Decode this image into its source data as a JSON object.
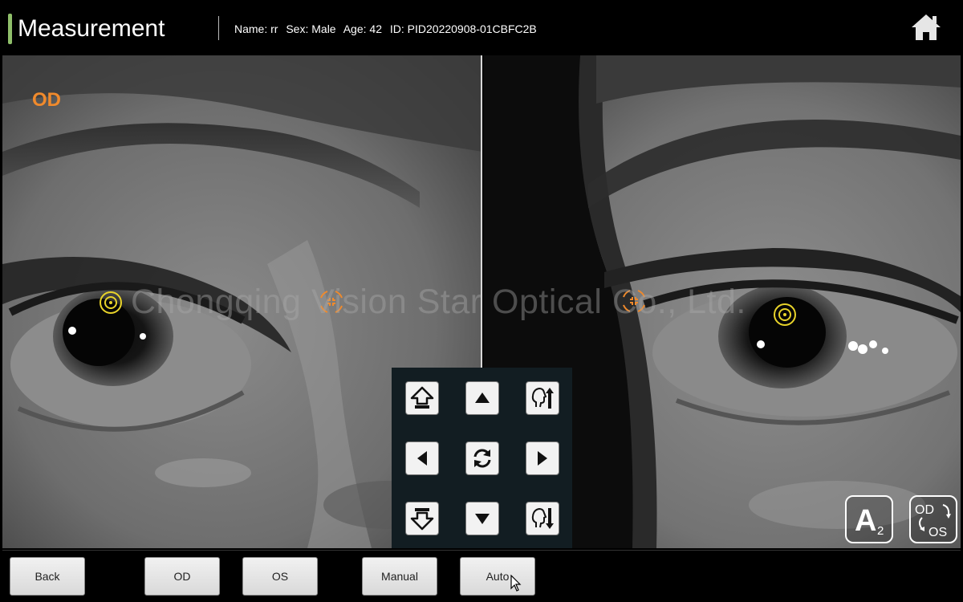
{
  "header": {
    "title": "Measurement",
    "patient": {
      "name": "Name: rr",
      "sex": "Sex: Male",
      "age": "Age: 42",
      "id": "ID: PID20220908-01CBFC2B"
    },
    "home_icon": "home-icon"
  },
  "views": {
    "left_label": "OD",
    "watermark": "Chongqing Vision Star Optical Co., Ltd."
  },
  "joystick": {
    "buttons": [
      {
        "name": "move-forward",
        "icon": "arrow-up-outline-icon"
      },
      {
        "name": "move-up",
        "icon": "triangle-up-icon"
      },
      {
        "name": "chinrest-up",
        "icon": "chinrest-up-icon"
      },
      {
        "name": "move-left",
        "icon": "triangle-left-icon"
      },
      {
        "name": "reset",
        "icon": "refresh-icon"
      },
      {
        "name": "move-right",
        "icon": "triangle-right-icon"
      },
      {
        "name": "move-backward",
        "icon": "arrow-down-outline-icon"
      },
      {
        "name": "move-down",
        "icon": "triangle-down-icon"
      },
      {
        "name": "chinrest-down",
        "icon": "chinrest-down-icon"
      }
    ]
  },
  "corner_buttons": {
    "auto_a2": {
      "letter": "A",
      "sub": "2"
    },
    "switch_eye": {
      "top": "OD",
      "bottom": "OS"
    }
  },
  "bottom": {
    "back": "Back",
    "od": "OD",
    "os": "OS",
    "manual": "Manual",
    "auto": "Auto"
  },
  "colors": {
    "accent_orange": "#f08a2c",
    "target_yellow": "#e8d32a",
    "title_accent": "#8fbf6a"
  }
}
